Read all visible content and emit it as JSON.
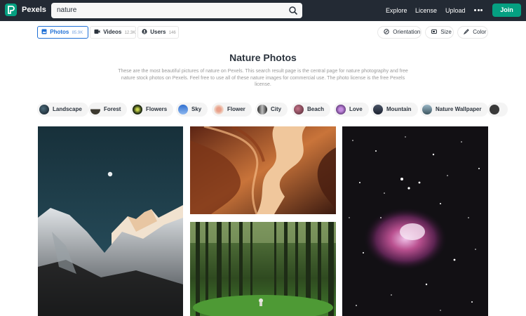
{
  "nav": {
    "brand": "Pexels",
    "search_value": "nature",
    "links": [
      "Explore",
      "License",
      "Upload"
    ],
    "join_label": "Join",
    "accent": "#05a081"
  },
  "tabs": [
    {
      "label": "Photos",
      "count": "85.9K",
      "icon": "image-icon",
      "active": true
    },
    {
      "label": "Videos",
      "count": "12.3K",
      "icon": "video-icon",
      "active": false
    },
    {
      "label": "Users",
      "count": "146",
      "icon": "user-icon",
      "active": false
    }
  ],
  "filters": [
    {
      "label": "Orientation",
      "icon": "orientation-icon"
    },
    {
      "label": "Size",
      "icon": "size-icon"
    },
    {
      "label": "Color",
      "icon": "brush-icon"
    }
  ],
  "main": {
    "title": "Nature Photos",
    "description": "These are the most beautiful pictures of nature on Pexels. This search result page is the central page for nature photography and free nature stock photos on Pexels. Feel free to use all of these nature images for commercial use. The photo license is the free Pexels license."
  },
  "chips": [
    "Landscape",
    "Forest",
    "Flowers",
    "Sky",
    "Flower",
    "City",
    "Beach",
    "Love",
    "Mountain",
    "Nature Wallpaper"
  ],
  "photos": [
    {
      "subject": "snowy mountain under moon"
    },
    {
      "subject": "sandstone canyon"
    },
    {
      "subject": "green forest"
    },
    {
      "subject": "orion nebula"
    }
  ]
}
